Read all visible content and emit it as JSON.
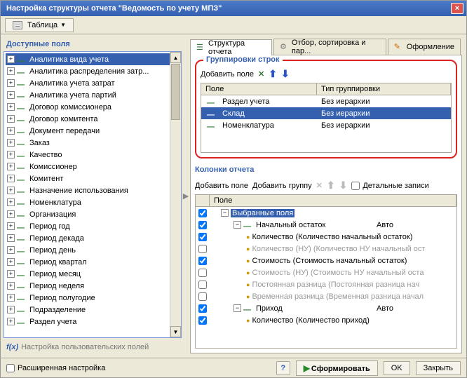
{
  "window": {
    "title": "Настройка структуры отчета \"Ведомость по учету МПЗ\""
  },
  "toolbar": {
    "view_mode": "Таблица"
  },
  "left": {
    "heading": "Доступные поля",
    "tree": [
      "Аналитика вида учета",
      "Аналитика распределения затр...",
      "Аналитика учета затрат",
      "Аналитика учета партий",
      "Договор комиссионера",
      "Договор комитента",
      "Документ передачи",
      "Заказ",
      "Качество",
      "Комиссионер",
      "Комитент",
      "Назначение использования",
      "Номенклатура",
      "Организация",
      "Период год",
      "Период декада",
      "Период день",
      "Период квартал",
      "Период месяц",
      "Период неделя",
      "Период полугодие",
      "Подразделение",
      "Раздел учета"
    ],
    "userfields": "Настройка пользовательских полей"
  },
  "tabs": {
    "t1": "Структура отчета",
    "t2": "Отбор, сортировка и пар...",
    "t3": "Оформление"
  },
  "groupings": {
    "title": "Группировки строк",
    "add_field": "Добавить поле",
    "col_field": "Поле",
    "col_type": "Тип группировки",
    "rows": [
      {
        "field": "Раздел учета",
        "type": "Без иерархии",
        "sel": false
      },
      {
        "field": "Склад",
        "type": "Без иерархии",
        "sel": true
      },
      {
        "field": "Номенклатура",
        "type": "Без иерархии",
        "sel": false
      }
    ]
  },
  "columns": {
    "title": "Колонки отчета",
    "add_field": "Добавить поле",
    "add_group": "Добавить группу",
    "detail": "Детальные записи",
    "head": "Поле",
    "rows": [
      {
        "kind": "root",
        "label": "Выбранные поля",
        "check": true,
        "sel": true
      },
      {
        "kind": "group",
        "label": "Начальный остаток",
        "auto": "Авто",
        "check": true
      },
      {
        "kind": "field",
        "label": "Количество (Количество начальный остаток)",
        "check": true
      },
      {
        "kind": "field",
        "label": "Количество (НУ) (Количество НУ начальный ост",
        "check": false,
        "dim": true
      },
      {
        "kind": "field",
        "label": "Стоимость (Стоимость начальный остаток)",
        "check": true
      },
      {
        "kind": "field",
        "label": "Стоимость (НУ) (Стоимость НУ начальный оста",
        "check": false,
        "dim": true
      },
      {
        "kind": "field",
        "label": "Постоянная разница (Постоянная разница нач",
        "check": false,
        "dim": true
      },
      {
        "kind": "field",
        "label": "Временная разница (Временная разница начал",
        "check": false,
        "dim": true
      },
      {
        "kind": "group",
        "label": "Приход",
        "auto": "Авто",
        "check": true
      },
      {
        "kind": "field",
        "label": "Количество (Количество приход)",
        "check": true
      }
    ]
  },
  "footer": {
    "advanced": "Расширенная настройка",
    "form": "Сформировать",
    "ok": "OK",
    "close": "Закрыть"
  }
}
